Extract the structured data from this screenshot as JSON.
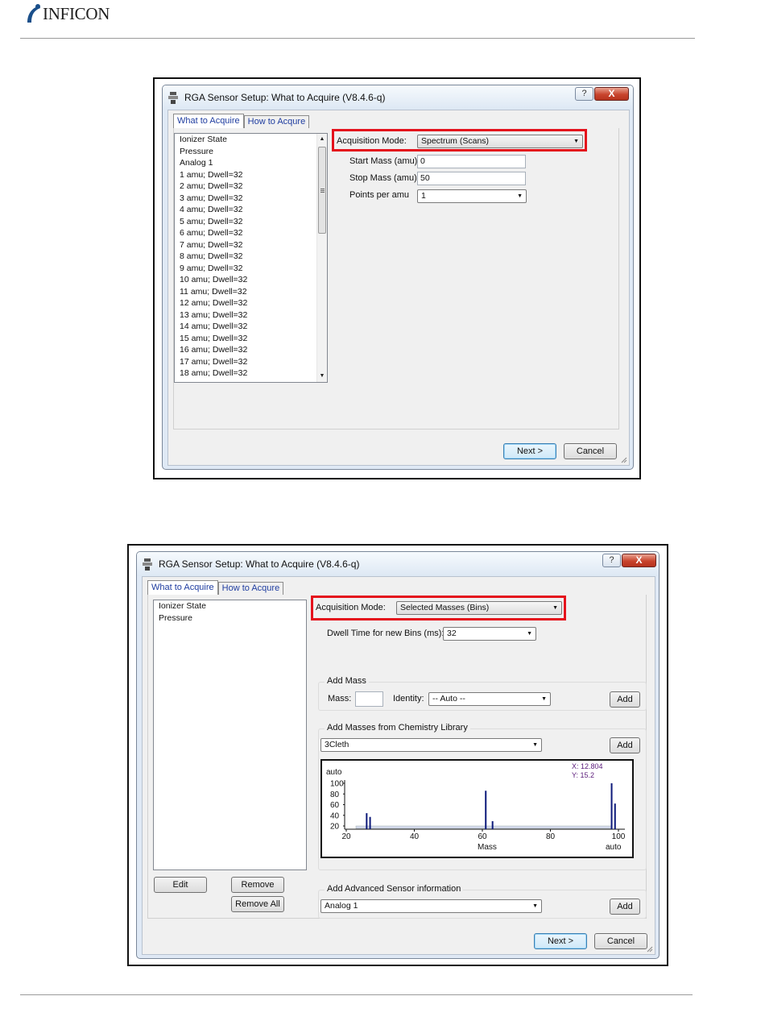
{
  "header": {
    "brand": "INFICON"
  },
  "dialog_top": {
    "title": "RGA Sensor Setup: What to Acquire  (V8.4.6-q)",
    "help_label": "?",
    "close_label": "X",
    "tabs": [
      {
        "label": "What to Acquire"
      },
      {
        "label": "How to Acqure"
      }
    ],
    "list_items": [
      "Ionizer State",
      "Pressure",
      "Analog 1",
      "1 amu; Dwell=32",
      "2 amu; Dwell=32",
      "3 amu; Dwell=32",
      "4 amu; Dwell=32",
      "5 amu; Dwell=32",
      "6 amu; Dwell=32",
      "7 amu; Dwell=32",
      "8 amu; Dwell=32",
      "9 amu; Dwell=32",
      "10 amu; Dwell=32",
      "11 amu; Dwell=32",
      "12 amu; Dwell=32",
      "13 amu; Dwell=32",
      "14 amu; Dwell=32",
      "15 amu; Dwell=32",
      "16 amu; Dwell=32",
      "17 amu; Dwell=32",
      "18 amu; Dwell=32"
    ],
    "acquisition_mode_label": "Acquisition Mode:",
    "acquisition_mode_value": "Spectrum (Scans)",
    "start_mass_label": "Start Mass (amu):",
    "start_mass_value": "0",
    "stop_mass_label": "Stop Mass (amu):",
    "stop_mass_value": "50",
    "points_label": "Points per amu",
    "points_value": "1",
    "next_label": "Next >",
    "cancel_label": "Cancel"
  },
  "dialog_bottom": {
    "title": "RGA Sensor Setup: What to Acquire  (V8.4.6-q)",
    "help_label": "?",
    "close_label": "X",
    "tabs": [
      {
        "label": "What to Acquire"
      },
      {
        "label": "How to Acqure"
      }
    ],
    "list_items": [
      "Ionizer State",
      "Pressure"
    ],
    "edit_label": "Edit",
    "remove_label": "Remove",
    "remove_all_label": "Remove All",
    "acquisition_mode_label": "Acquisition Mode:",
    "acquisition_mode_value": "Selected Masses (Bins)",
    "dwell_label": "Dwell Time for new Bins (ms):",
    "dwell_value": "32",
    "add_mass_group": "Add Mass",
    "mass_label": "Mass:",
    "mass_value": "",
    "identity_label": "Identity:",
    "identity_value": "-- Auto --",
    "add_label": "Add",
    "chem_group": "Add Masses from Chemistry Library",
    "chem_value": "3Cleth",
    "adv_group": "Add Advanced Sensor information",
    "adv_value": "Analog 1",
    "next_label": "Next >",
    "cancel_label": "Cancel"
  },
  "chart_data": {
    "type": "bar",
    "xlabel": "Mass",
    "x_ticks": [
      "20",
      "40",
      "60",
      "80",
      "100"
    ],
    "x_right_label": "auto",
    "y_top_label": "auto",
    "y_ticks": [
      "100",
      "80",
      "60",
      "40",
      "20"
    ],
    "xlim": [
      20,
      100
    ],
    "ylim": [
      20,
      100
    ],
    "cursor_x": "X: 12.804",
    "cursor_y": "Y: 15.2",
    "x": [
      26,
      27,
      61,
      63,
      98,
      99
    ],
    "values": [
      44,
      37,
      86,
      29,
      100,
      62
    ],
    "bar_color": "#0d1a7a"
  }
}
